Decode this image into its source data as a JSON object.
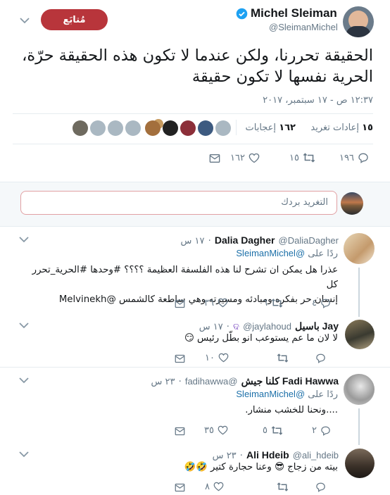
{
  "header": {
    "display_name": "Michel Sleiman",
    "handle": "@SleimanMichel",
    "follow_label": "مُتابَع"
  },
  "main_tweet": {
    "text": "الحقيقة تحررنا، ولكن عندما لا تكون هذه الحقيقة حرّة، الحرية نفسها لا تكون حقيقة",
    "timestamp": "١٢:٣٧ ص - ١٧ سبتمبر، ٢٠١٧",
    "retweets_count": "١٥",
    "retweets_label": "إعادات تغريد",
    "likes_count": "١٦٢",
    "likes_label": "إعجابات",
    "actions": {
      "replies": "١٩٦",
      "retweets": "١٥",
      "likes": "١٦٢"
    }
  },
  "reply_box": {
    "placeholder": "التغريد بردك"
  },
  "replies": [
    {
      "name": "Dalia Dagher",
      "handle": "@DaliaDagher",
      "time": "١٧ س",
      "replying_prefix": "ردًا على",
      "replying_to": "@SleimanMichel",
      "text_lines": [
        "عذرا هل يمكن ان تشرح لنا هذه الفلسفة العظيمة ؟؟؟؟ #وحدها #الحرية_تحرر كل",
        "إنسان حر بفكره ومبادئه ومسيرته وهي ساطعة كالشمس @Melvinekh"
      ],
      "actions": {
        "replies": "٤",
        "retweets": "٦",
        "likes": "٣٦"
      }
    },
    {
      "name": "Jay باسيل",
      "handle": "@jaylahoud",
      "time": "١٧ س",
      "text": "لا لان ما عم يستوعب انو بطّل رئيس 😏",
      "actions": {
        "replies": "",
        "retweets": "",
        "likes": "١٠"
      }
    },
    {
      "name": "Fadi Hawwa كلنا جيش",
      "handle": "@fadihawwa",
      "time": "٢٣ س",
      "replying_prefix": "ردًا على",
      "replying_to": "@SleimanMichel",
      "text": "....ونحنا للخشب منشار.",
      "actions": {
        "replies": "٢",
        "retweets": "٥",
        "likes": "٣٥"
      }
    },
    {
      "name": "Ali Hdeib",
      "handle": "@ali_hdeib",
      "time": "٢٣ س",
      "text": "بيته من زجاج 😎 وعنا حجارة كتير 🤣🤣",
      "actions": {
        "replies": "",
        "retweets": "",
        "likes": "٨"
      }
    }
  ],
  "colors": {
    "follow_bg": "#b8353b",
    "verified": "#1da1f2",
    "link": "#1b6fa8",
    "muted": "#657786"
  }
}
